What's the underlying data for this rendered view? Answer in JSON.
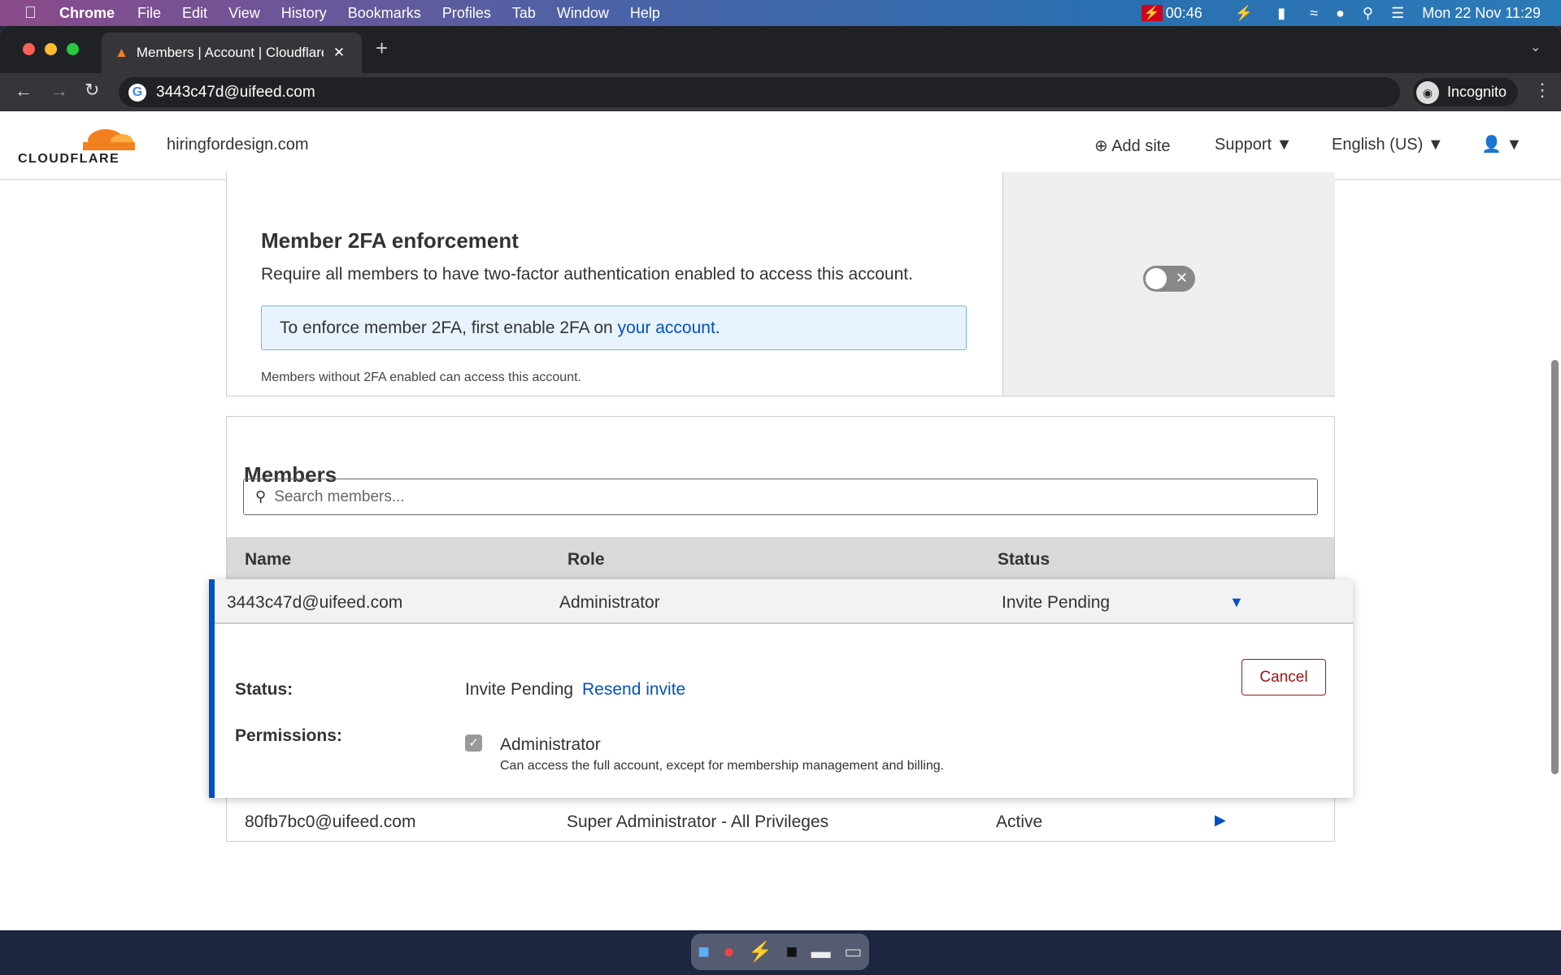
{
  "menubar": {
    "app": "Chrome",
    "items": [
      "File",
      "Edit",
      "View",
      "History",
      "Bookmarks",
      "Profiles",
      "Tab",
      "Window",
      "Help"
    ],
    "timer": "00:46",
    "datetime": "Mon 22 Nov  11:29"
  },
  "browser": {
    "tab_title": "Members | Account | Cloudflare",
    "url": "3443c47d@uifeed.com",
    "incognito": "Incognito"
  },
  "header": {
    "logo": "CLOUDFLARE",
    "domain": "hiringfordesign.com",
    "add_site": "Add site",
    "support": "Support",
    "language": "English (US)"
  },
  "twofa": {
    "title": "Member 2FA enforcement",
    "description": "Require all members to have two-factor authentication enabled to access this account.",
    "notice_prefix": "To enforce member 2FA, first enable 2FA on ",
    "notice_link": "your account",
    "notice_suffix": ".",
    "footnote": "Members without 2FA enabled can access this account.",
    "toggle_on": false
  },
  "members": {
    "title": "Members",
    "search_placeholder": "Search members...",
    "columns": [
      "Name",
      "Role",
      "Status"
    ],
    "rows": [
      {
        "name": "3443c47d@uifeed.com",
        "role": "Administrator",
        "status": "Invite Pending",
        "expanded": true
      },
      {
        "name": "80fb7bc0@uifeed.com",
        "role": "Super Administrator - All Privileges",
        "status": "Active",
        "expanded": false
      }
    ],
    "detail": {
      "status_label": "Status:",
      "status_value": "Invite Pending",
      "resend": "Resend invite",
      "cancel": "Cancel",
      "permissions_label": "Permissions:",
      "permission_name": "Administrator",
      "permission_desc": "Can access the full account, except for membership management and billing.",
      "permission_checked": true
    }
  },
  "colors": {
    "accent": "#0051c3",
    "cancel": "#a3141a",
    "orange": "#f38020"
  }
}
